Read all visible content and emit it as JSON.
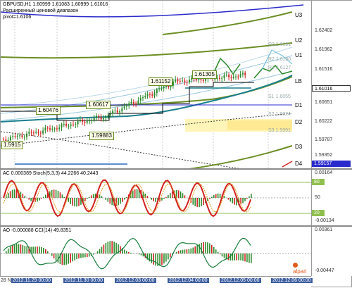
{
  "main": {
    "symbol_line": "GBPUSD,H1  1.60999 1.61083 1.60999 1.61016",
    "note_line": "Расширенный ценовой диапазон",
    "pivot_line": "pivot=1.6106",
    "levels": [
      "U3",
      "U2",
      "U1",
      "LB",
      "D1",
      "D2",
      "D3",
      "D4"
    ],
    "boxes": [
      "1.60476",
      "1.60617",
      "1.61152",
      "1.61305",
      "1.59883",
      "1.5915"
    ],
    "price_labels": [
      "1.62402",
      "1.61962",
      "1.61516",
      "1.61016",
      "1.60651",
      "1.60222",
      "1.59787",
      "1.59352",
      "1.59157",
      "1.58917"
    ],
    "current_price": "1.61016",
    "blue_price": "1.59157",
    "small_labels": [
      "R3 1.6191",
      "R2 1.6160",
      "R1 1.6127",
      "S1 1.6055",
      "S2 1.6024",
      "S3 1.5991"
    ]
  },
  "ac_pane": {
    "header": "AC 0.000389  Stoch(5,3,3) 44.2266 40.2443",
    "ticks": [
      "0.00164",
      "80",
      "50",
      "20",
      "-0.00134"
    ]
  },
  "ao_pane": {
    "header": "AO -0.000088  CCI(14) 49.8351",
    "ticks": [
      "0.00361",
      "-0.00447"
    ]
  },
  "x_axis": {
    "ticks": [
      "28 Nov 2012",
      "2012.11.29 00:00",
      "2012.11.30 00:00",
      "2012.12.03 00:00",
      "2012.12.04 00:00",
      "2012.12.05 00:00",
      "2012.12.06 00:00"
    ]
  },
  "logo": {
    "text": "alpari"
  },
  "colors": {
    "price_line": "#1a7f8e",
    "olive": "#6b8e23",
    "blue": "#2a2acc",
    "red": "#d42020",
    "black": "#000000",
    "green": "#2aa02a",
    "yellow": "#fff2a8"
  }
}
